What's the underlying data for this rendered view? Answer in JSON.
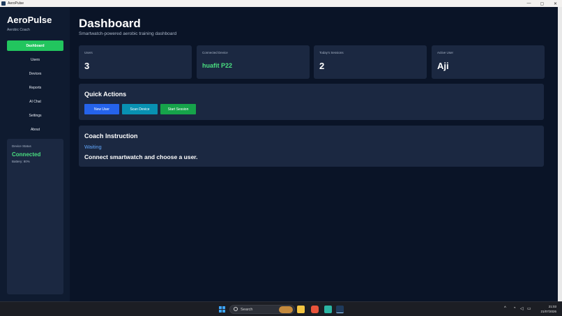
{
  "window": {
    "title": "AeroPulse",
    "controls": {
      "minimize": "—",
      "maximize": "▢",
      "close": "✕"
    }
  },
  "sidebar": {
    "brand": "AeroPulse",
    "subtitle": "Aerobic Coach",
    "items": [
      {
        "label": "Dashboard",
        "active": true
      },
      {
        "label": "Users",
        "active": false
      },
      {
        "label": "Devices",
        "active": false
      },
      {
        "label": "Reports",
        "active": false
      },
      {
        "label": "AI Chat",
        "active": false
      },
      {
        "label": "Settings",
        "active": false
      },
      {
        "label": "About",
        "active": false
      }
    ],
    "device_status": {
      "label": "Device Status",
      "state": "Connected",
      "battery": "Battery: 80%"
    }
  },
  "main": {
    "title": "Dashboard",
    "subtitle": "Smartwatch-powered aerobic training dashboard",
    "stats": [
      {
        "label": "Users",
        "value": "3"
      },
      {
        "label": "Connected Device",
        "value": "huafit P22"
      },
      {
        "label": "Today's Sessions",
        "value": "2"
      },
      {
        "label": "Active User",
        "value": "Aji"
      }
    ],
    "quick_actions": {
      "title": "Quick Actions",
      "buttons": [
        "New User",
        "Scan Device",
        "Start Session"
      ]
    },
    "coach": {
      "title": "Coach Instruction",
      "status": "Waiting",
      "message": "Connect smartwatch and choose a user."
    }
  },
  "taskbar": {
    "search_placeholder": "Search",
    "time": "21:03",
    "date": "21/07/2026"
  },
  "colors": {
    "accent_green": "#22c55e",
    "connected_green": "#4ade80",
    "status_blue": "#60a5fa",
    "background": "#0a1427",
    "card": "#1b2841"
  }
}
